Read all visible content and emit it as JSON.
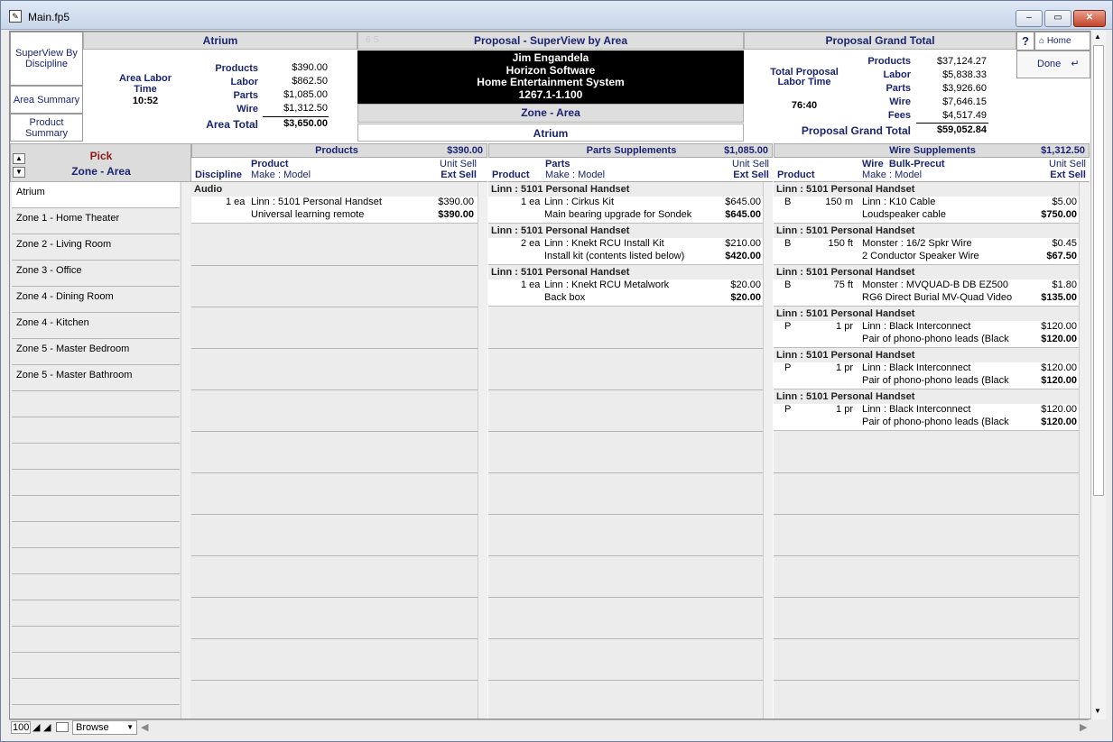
{
  "window": {
    "title": "Main.fp5",
    "min": "–",
    "max": "▭",
    "close": "✕"
  },
  "side_nav": [
    "SuperView By Discipline",
    "Area Summary",
    "Product Summary"
  ],
  "area": {
    "name": "Atrium",
    "labor_label": "Area Labor Time",
    "labor_time": "10:52",
    "rows": [
      {
        "label": "Products",
        "value": "$390.00"
      },
      {
        "label": "Labor",
        "value": "$862.50"
      },
      {
        "label": "Parts",
        "value": "$1,085.00"
      },
      {
        "label": "Wire",
        "value": "$1,312.50"
      }
    ],
    "total_label": "Area Total",
    "total_value": "$3,650.00"
  },
  "proposal": {
    "title": "Proposal - SuperView by Area",
    "faint": "6 S",
    "client": "Jim Engandela",
    "company": "Horizon Software",
    "system": "Home Entertainment System",
    "code": "1267.1-1.100",
    "zone_label": "Zone - Area",
    "zone_value": "Atrium"
  },
  "grand": {
    "title": "Proposal Grand Total",
    "labor_label": "Total Proposal Labor Time",
    "labor_time": "76:40",
    "rows": [
      {
        "label": "Products",
        "value": "$37,124.27"
      },
      {
        "label": "Labor",
        "value": "$5,838.33"
      },
      {
        "label": "Parts",
        "value": "$3,926.60"
      },
      {
        "label": "Wire",
        "value": "$7,646.15"
      },
      {
        "label": "Fees",
        "value": "$4,517.49"
      }
    ],
    "total_label": "Proposal Grand Total",
    "total_value": "$59,052.84"
  },
  "toolbar": {
    "help": "?",
    "home": "Home",
    "done": "Done"
  },
  "pick": {
    "title": "Pick",
    "subtitle": "Zone - Area"
  },
  "zones": [
    "Atrium",
    "Zone 1 - Home Theater",
    "Zone 2 - Living Room",
    "Zone 3 - Office",
    "Zone 4 - Dining Room",
    "Zone 4 - Kitchen",
    "Zone 5 - Master Bedroom",
    "Zone 5 - Master Bathroom"
  ],
  "products": {
    "title": "Products",
    "total": "$390.00",
    "h_discipline": "Discipline",
    "h_product": "Product",
    "h_makemodel": "Make : Model",
    "h_unit": "Unit Sell",
    "h_ext": "Ext Sell",
    "discipline": "Audio",
    "item": {
      "qty": "1 ea",
      "name": "Linn : 5101 Personal Handset",
      "desc": "Universal learning remote",
      "unit": "$390.00",
      "ext": "$390.00"
    }
  },
  "parts": {
    "title": "Parts Supplements",
    "total": "$1,085.00",
    "h_product": "Product",
    "h_parts": "Parts",
    "h_makemodel": "Make : Model",
    "h_unit": "Unit Sell",
    "h_ext": "Ext Sell",
    "groups": [
      {
        "head": "Linn : 5101 Personal Handset",
        "qty": "1 ea",
        "name": "Linn : Cirkus Kit",
        "desc": "Main bearing upgrade for Sondek",
        "unit": "$645.00",
        "ext": "$645.00"
      },
      {
        "head": "Linn : 5101 Personal Handset",
        "qty": "2 ea",
        "name": "Linn : Knekt RCU Install Kit",
        "desc": "Install kit (contents listed below)",
        "unit": "$210.00",
        "ext": "$420.00"
      },
      {
        "head": "Linn : 5101 Personal Handset",
        "qty": "1 ea",
        "name": "Linn : Knekt RCU Metalwork",
        "desc": "Back box",
        "unit": "$20.00",
        "ext": "$20.00"
      }
    ]
  },
  "wire": {
    "title": "Wire Supplements",
    "total": "$1,312.50",
    "h_product": "Product",
    "h_wire": "Wire  Bulk-Precut",
    "h_makemodel": "Make : Model",
    "h_unit": "Unit Sell",
    "h_ext": "Ext Sell",
    "groups": [
      {
        "head": "Linn : 5101 Personal Handset",
        "type": "B",
        "qty": "150 m",
        "name": "Linn : K10 Cable",
        "desc": "Loudspeaker cable",
        "unit": "$5.00",
        "ext": "$750.00"
      },
      {
        "head": "Linn : 5101 Personal Handset",
        "type": "B",
        "qty": "150 ft",
        "name": "Monster : 16/2 Spkr Wire",
        "desc": "2 Conductor Speaker Wire",
        "unit": "$0.45",
        "ext": "$67.50"
      },
      {
        "head": "Linn : 5101 Personal Handset",
        "type": "B",
        "qty": "75 ft",
        "name": "Monster : MVQUAD-B DB EZ500",
        "desc": "RG6 Direct Burial MV-Quad Video",
        "unit": "$1.80",
        "ext": "$135.00"
      },
      {
        "head": "Linn : 5101 Personal Handset",
        "type": "P",
        "qty": "1 pr",
        "name": "Linn : Black Interconnect",
        "desc": "Pair of phono-phono leads (Black",
        "unit": "$120.00",
        "ext": "$120.00"
      },
      {
        "head": "Linn : 5101 Personal Handset",
        "type": "P",
        "qty": "1 pr",
        "name": "Linn : Black Interconnect",
        "desc": "Pair of phono-phono leads (Black",
        "unit": "$120.00",
        "ext": "$120.00"
      },
      {
        "head": "Linn : 5101 Personal Handset",
        "type": "P",
        "qty": "1 pr",
        "name": "Linn : Black Interconnect",
        "desc": "Pair of phono-phono leads (Black",
        "unit": "$120.00",
        "ext": "$120.00"
      }
    ]
  },
  "status": {
    "zoom": "100",
    "mode": "Browse"
  }
}
